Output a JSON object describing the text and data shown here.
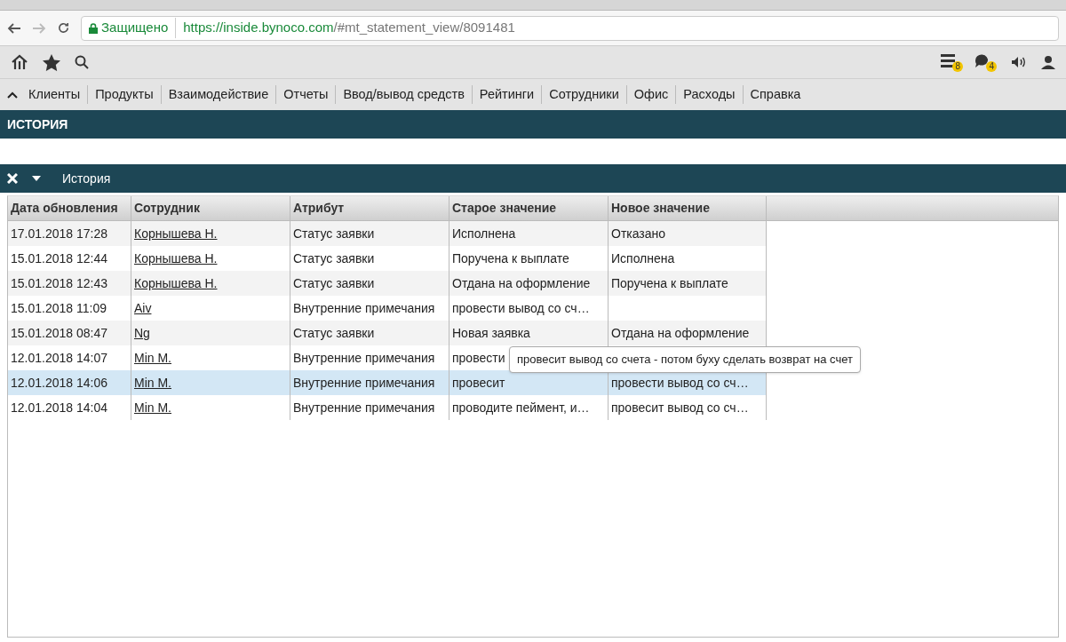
{
  "browser": {
    "security_label": "Защищено",
    "url_host": "https://inside.bynoco.com",
    "url_path": "/#mt_statement_view/8091481"
  },
  "toolbar": {
    "badges": [
      {
        "kind": "list",
        "count": "8"
      },
      {
        "kind": "chat",
        "count": "4"
      }
    ]
  },
  "menu": {
    "items": [
      "Клиенты",
      "Продукты",
      "Взаимодействие",
      "Отчеты",
      "Ввод/вывод средств",
      "Рейтинги",
      "Сотрудники",
      "Офис",
      "Расходы",
      "Справка"
    ]
  },
  "page_title": "ИСТОРИЯ",
  "panel": {
    "title": "История"
  },
  "table": {
    "columns": [
      "Дата обновления",
      "Сотрудник",
      "Атрибут",
      "Старое значение",
      "Новое значение"
    ],
    "rows": [
      {
        "selected": false,
        "cells": [
          "17.01.2018 17:28",
          "Корнышева Н.",
          "Статус заявки",
          "Исполнена",
          "Отказано"
        ]
      },
      {
        "selected": false,
        "cells": [
          "15.01.2018 12:44",
          "Корнышева Н.",
          "Статус заявки",
          "Поручена к выплате",
          "Исполнена"
        ]
      },
      {
        "selected": false,
        "cells": [
          "15.01.2018 12:43",
          "Корнышева Н.",
          "Статус заявки",
          "Отдана на оформление",
          "Поручена к выплате"
        ]
      },
      {
        "selected": false,
        "cells": [
          "15.01.2018 11:09",
          "Aiv",
          "Внутренние примечания",
          "провести вывод со сч…",
          ""
        ]
      },
      {
        "selected": false,
        "cells": [
          "15.01.2018 08:47",
          "Ng",
          "Статус заявки",
          "Новая заявка",
          "Отдана на оформление"
        ]
      },
      {
        "selected": false,
        "cells": [
          "12.01.2018 14:07",
          "Min M.",
          "Внутренние примечания",
          "провести",
          ""
        ]
      },
      {
        "selected": true,
        "cells": [
          "12.01.2018 14:06",
          "Min M.",
          "Внутренние примечания",
          "провесит",
          "провести вывод со сч…"
        ]
      },
      {
        "selected": false,
        "cells": [
          "12.01.2018 14:04",
          "Min M.",
          "Внутренние примечания",
          "проводите пеймент, и…",
          "провесит вывод со сч…"
        ]
      }
    ]
  },
  "tooltip": "провесит вывод со счета - потом буху сделать возврат на счет"
}
